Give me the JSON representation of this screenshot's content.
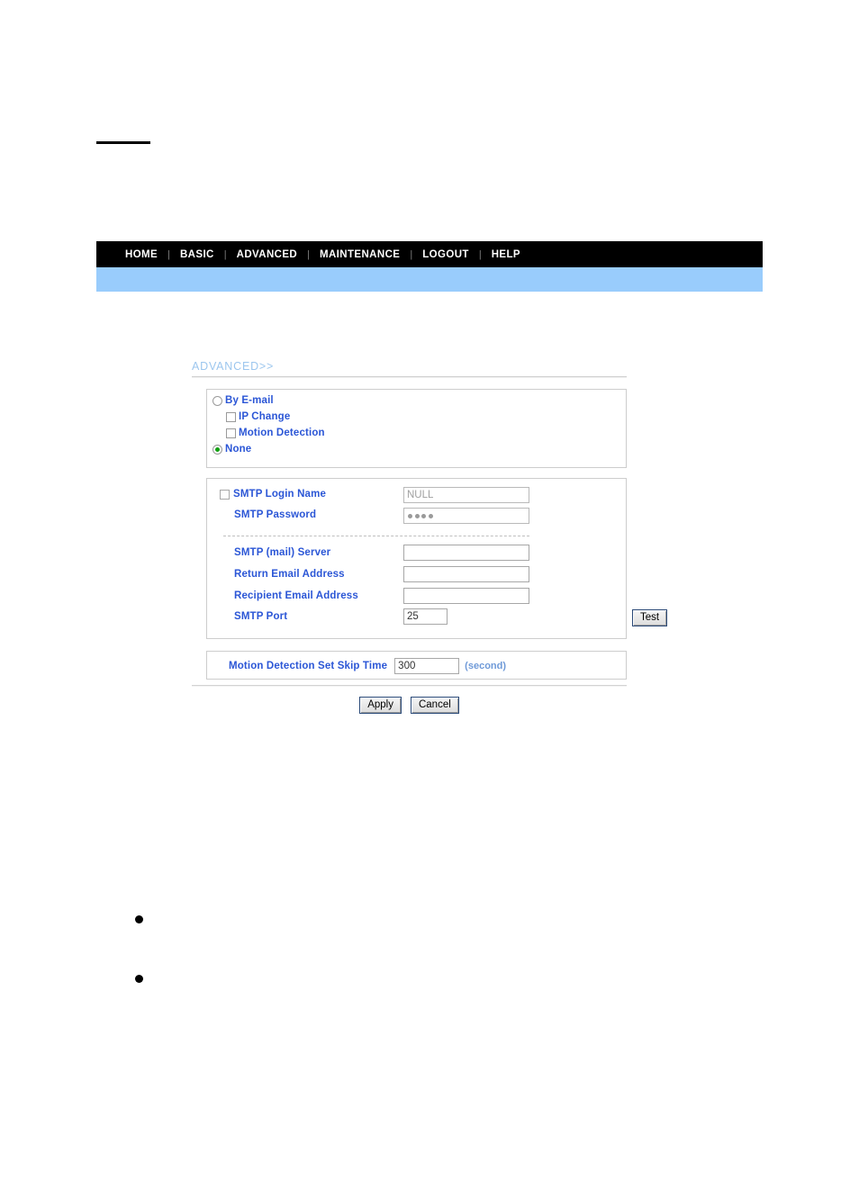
{
  "page": {
    "top_rule": "",
    "bullets": [
      "",
      ""
    ]
  },
  "nav": {
    "items": [
      {
        "label": "HOME"
      },
      {
        "label": "BASIC"
      },
      {
        "label": "ADVANCED"
      },
      {
        "label": "MAINTENANCE"
      },
      {
        "label": "LOGOUT"
      },
      {
        "label": "HELP"
      }
    ],
    "separator": "|"
  },
  "breadcrumb": {
    "label": "ADVANCED>>"
  },
  "trigger": {
    "by_email": {
      "label": "By E-mail",
      "checked": false
    },
    "ip_change": {
      "label": "IP Change",
      "checked": false
    },
    "motion_detection": {
      "label": "Motion Detection",
      "checked": false
    },
    "none": {
      "label": "None",
      "checked": true
    }
  },
  "smtp": {
    "login_name": {
      "label": "SMTP Login Name",
      "value": "NULL",
      "checkbox_checked": false,
      "disabled": true
    },
    "password": {
      "label": "SMTP Password",
      "masked_length": 4,
      "disabled": true
    },
    "mail_server": {
      "label": "SMTP (mail) Server",
      "value": ""
    },
    "return_email": {
      "label": "Return Email Address",
      "value": ""
    },
    "recipient_email": {
      "label": "Recipient Email Address",
      "value": ""
    },
    "port": {
      "label": "SMTP Port",
      "value": "25"
    },
    "test_button": {
      "label": "Test"
    }
  },
  "skip_time": {
    "label": "Motion Detection Set Skip Time",
    "value": "300",
    "unit": "(second)"
  },
  "actions": {
    "apply": "Apply",
    "cancel": "Cancel"
  },
  "colors": {
    "nav_bg": "#000000",
    "banner": "#99ccfc",
    "label_blue": "#2b56d6",
    "breadcrumb_blue": "#9cc6ee",
    "radio_on": "#11a011",
    "unit_blue": "#6f9ad8"
  }
}
